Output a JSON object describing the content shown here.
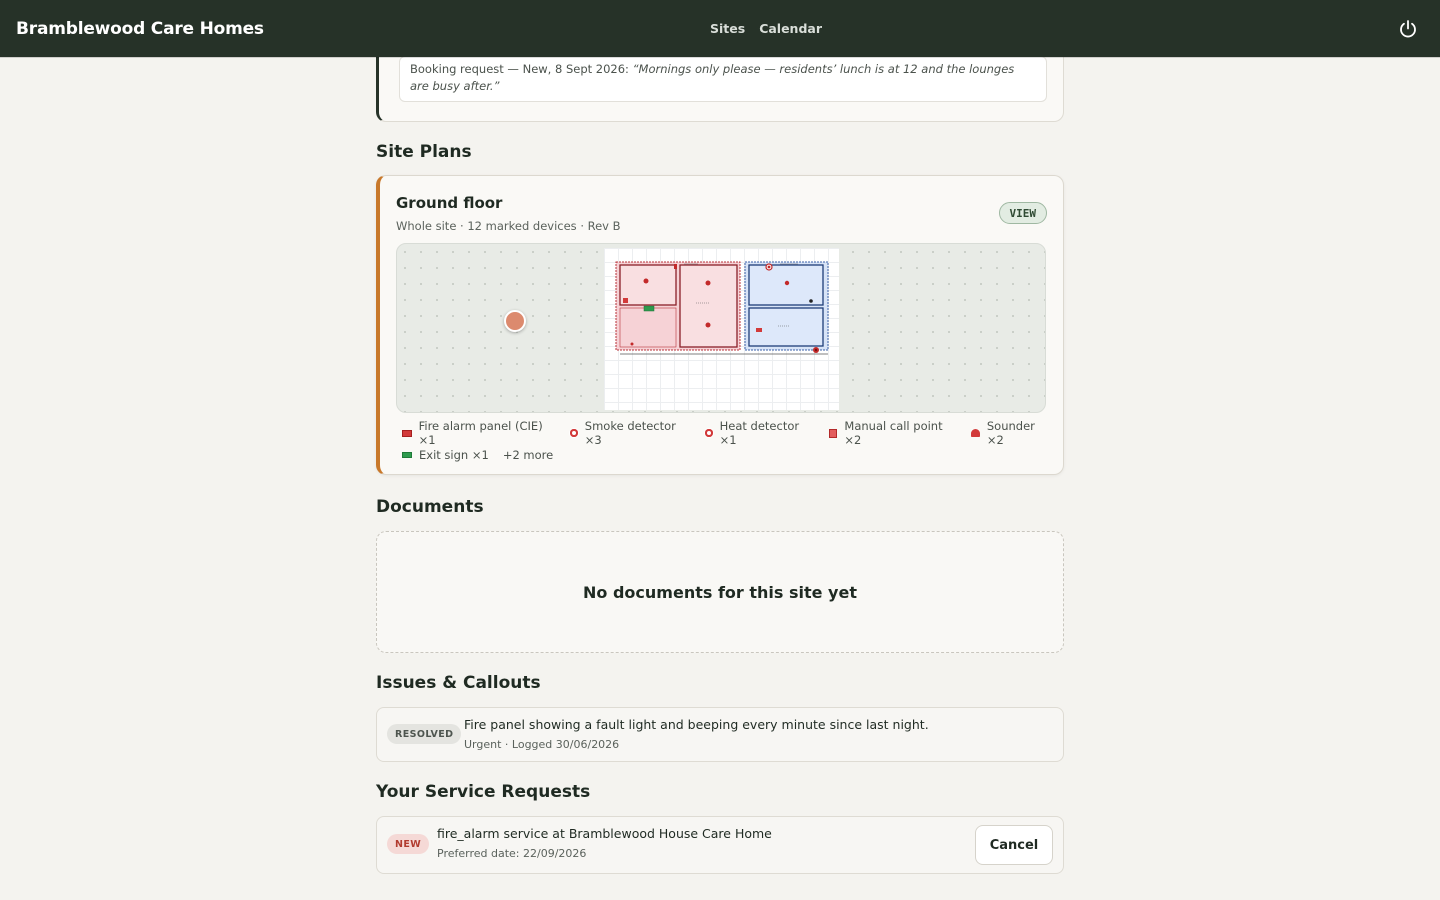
{
  "header": {
    "brand": "Bramblewood Care Homes",
    "nav": [
      "Sites",
      "Calendar"
    ],
    "power_icon": "power-icon",
    "bg_color": "#263228"
  },
  "booking": {
    "prefix": "Booking request — New, 8 Sept 2026: ",
    "quote": "“Mornings only please — residents’ lunch is at 12 and the lounges are busy after.”"
  },
  "site_plans": {
    "title": "Site Plans",
    "plan": {
      "name": "Ground floor",
      "meta": "Whole site · 12 marked devices · Rev B",
      "badge": "VIEW",
      "accent_color": "#c8782a",
      "legend": [
        {
          "icon": "fire-alarm-panel-icon",
          "label": "Fire alarm panel (CIE) ×1"
        },
        {
          "icon": "smoke-detector-icon",
          "label": "Smoke detector ×3"
        },
        {
          "icon": "heat-detector-icon",
          "label": "Heat detector ×1"
        },
        {
          "icon": "manual-call-point-icon",
          "label": "Manual call point ×2"
        },
        {
          "icon": "sounder-icon",
          "label": "Sounder ×2"
        },
        {
          "icon": "exit-sign-icon",
          "label": "Exit sign ×1"
        }
      ],
      "more": "+2 more"
    }
  },
  "documents": {
    "title": "Documents",
    "empty": "No documents for this site yet"
  },
  "issues": {
    "title": "Issues & Callouts",
    "items": [
      {
        "status": "RESOLVED",
        "text": "Fire panel showing a fault light and beeping every minute since last night.",
        "sub": "Urgent · Logged 30/06/2026"
      }
    ]
  },
  "requests": {
    "title": "Your Service Requests",
    "items": [
      {
        "status": "NEW",
        "text": "fire_alarm service at Bramblewood House Care Home",
        "sub": "Preferred date: 22/09/2026",
        "action": "Cancel"
      }
    ]
  }
}
